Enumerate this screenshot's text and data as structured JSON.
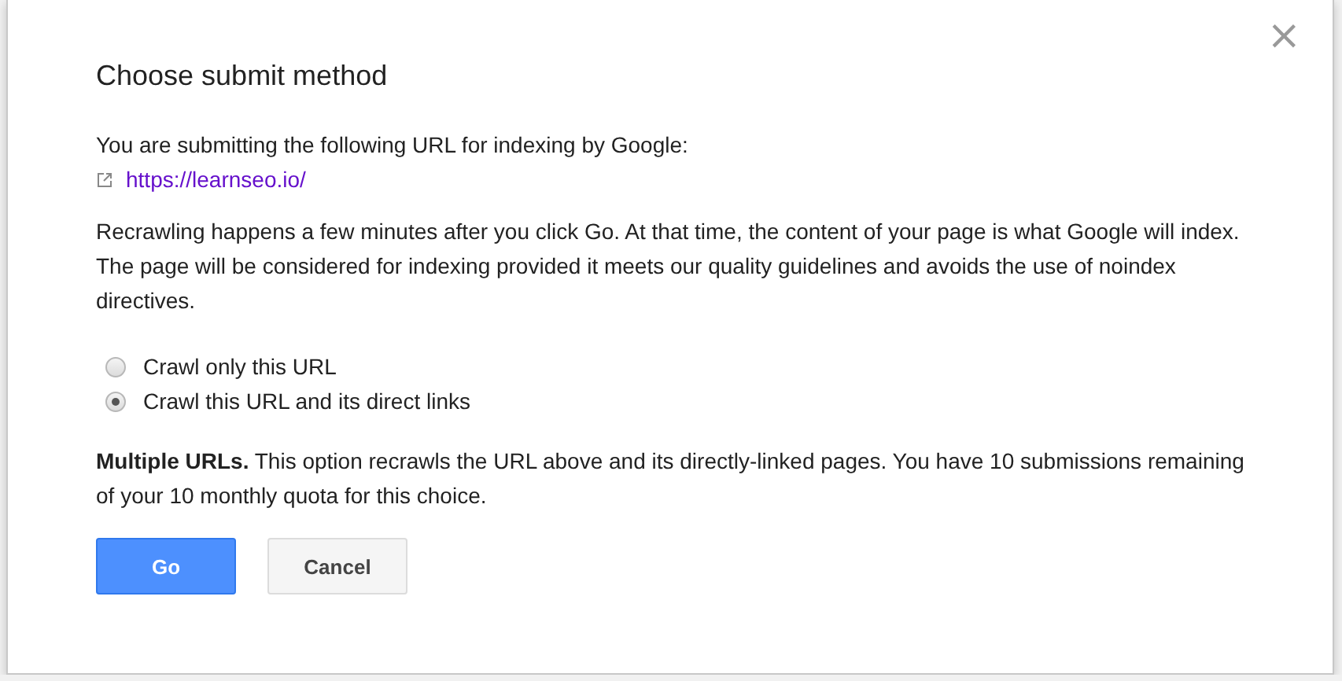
{
  "dialog": {
    "title": "Choose submit method",
    "close": "×",
    "intro": "You are submitting the following URL for indexing by Google:",
    "url": "https://learnseo.io/",
    "description": "Recrawling happens a few minutes after you click Go. At that time, the content of your page is what Google will index. The page will be considered for indexing provided it meets our quality guidelines and avoids the use of noindex directives.",
    "options": [
      {
        "label": "Crawl only this URL",
        "selected": false
      },
      {
        "label": "Crawl this URL and its direct links",
        "selected": true
      }
    ],
    "note": "**Multiple URLs.** This option recrawls the URL above and its directly-linked pages. You have 10 submissions remaining of your 10 monthly quota for this choice.",
    "buttons": [
      {
        "label": "Go",
        "kind": "primary"
      },
      {
        "label": "Cancel",
        "kind": "secondary"
      }
    ]
  }
}
